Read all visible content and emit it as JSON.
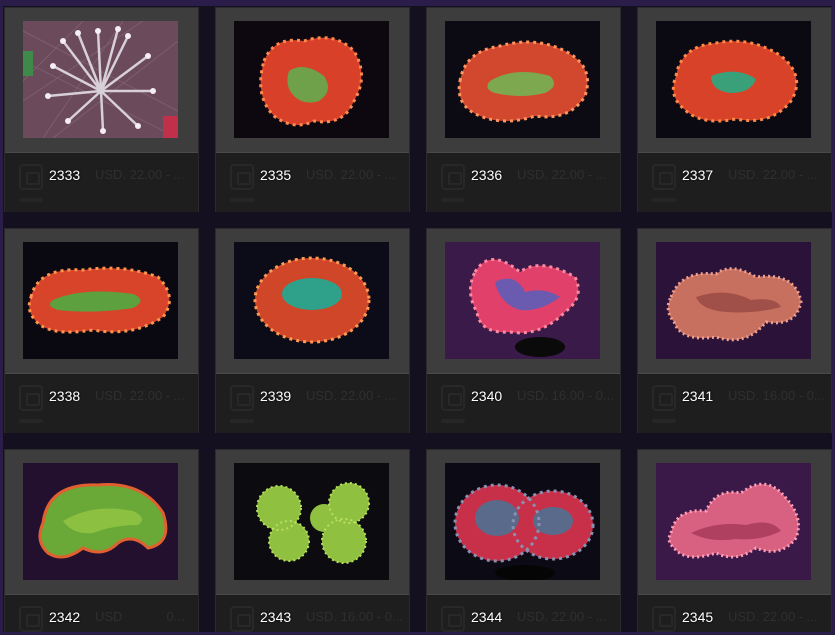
{
  "gallery": {
    "items": [
      {
        "lot": "2333",
        "price": "USD. 22.00 - ...",
        "image": "torch-coral-photo"
      },
      {
        "lot": "2335",
        "price": "USD. 22.00 - ...",
        "image": "red-brain-coral-photo"
      },
      {
        "lot": "2336",
        "price": "USD. 22.00 - ...",
        "image": "red-brain-coral-photo"
      },
      {
        "lot": "2337",
        "price": "USD. 22.00 - ...",
        "image": "red-brain-coral-photo"
      },
      {
        "lot": "2338",
        "price": "USD. 22.00 - ...",
        "image": "red-green-brain-coral-photo"
      },
      {
        "lot": "2339",
        "price": "USD. 22.00 - ...",
        "image": "red-teal-brain-coral-photo"
      },
      {
        "lot": "2340",
        "price": "USD. 16.00 - 0...",
        "image": "pink-brain-coral-photo"
      },
      {
        "lot": "2341",
        "price": "USD. 16.00 - 0...",
        "image": "pink-brain-coral-photo"
      },
      {
        "lot": "2342",
        "price": "USD",
        "price_tail": "0...",
        "image": "green-brain-coral-photo"
      },
      {
        "lot": "2343",
        "price": "USD. 16.00 - 0...",
        "image": "green-brain-coral-photo"
      },
      {
        "lot": "2344",
        "price": "USD. 22.00 - ...",
        "image": "rainbow-brain-coral-photo"
      },
      {
        "lot": "2345",
        "price": "USD. 22.00 - ...",
        "image": "pink-brain-coral-photo"
      }
    ]
  },
  "colors": {
    "page_background": "#14101f",
    "frame": "#2a1d4a",
    "thumb_panel": "#3d3d3d",
    "card": "#1c1c1c",
    "lot_text": "#ffffff",
    "price_text": "#2f2f2f"
  }
}
